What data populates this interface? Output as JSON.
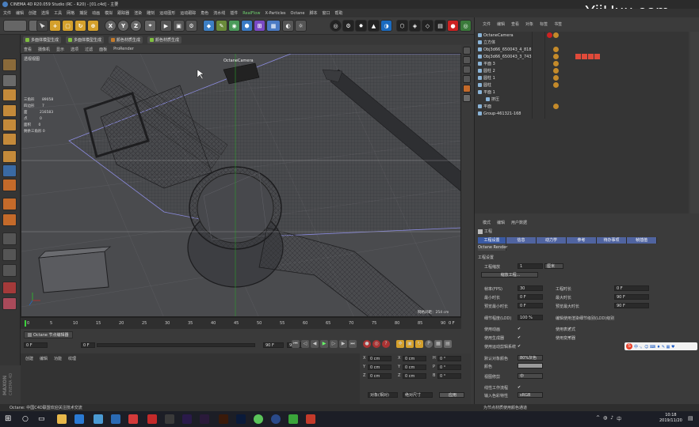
{
  "window": {
    "title": "CINEMA 4D R20.059 Studio (RC - R20) - [01.c4d] - 主要"
  },
  "watermark": "YiiHuu.com",
  "menu": [
    "文件",
    "编辑",
    "创建",
    "选择",
    "工具",
    "网格",
    "捕捉",
    "动画",
    "模拟",
    "跟踪器",
    "渲染",
    "雕刻",
    "运动图形",
    "运动跟踪",
    "角色",
    "流水线",
    "插件",
    "RealFlow",
    "X-Particles",
    "Octane",
    "脚本",
    "窗口",
    "帮助"
  ],
  "toolbar": {
    "axis": [
      "X",
      "Y",
      "Z"
    ]
  },
  "subtoolbar": [
    "多面体模型生成",
    "多面体模型生成",
    "颜色材质生成",
    "颜色材质生成"
  ],
  "viewport": {
    "menu": [
      "查看",
      "摄像机",
      "显示",
      "选项",
      "过滤",
      "面板",
      "ProRender"
    ],
    "view_name": "透视视图",
    "camera_label": "OctaneCamera",
    "stats": [
      {
        "label": "三角形",
        "value": "89058"
      },
      {
        "label": "四边形",
        "value": "7"
      },
      {
        "label": "面",
        "value": "216583"
      },
      {
        "label": "点",
        "value": "0"
      },
      {
        "label": "面积",
        "value": "0"
      }
    ],
    "stats_extra": "剩余三角形 0",
    "grid_spacing": "网格间距：254 cm"
  },
  "timeline": {
    "ticks": [
      "0",
      "5",
      "10",
      "15",
      "20",
      "25",
      "30",
      "35",
      "40",
      "45",
      "50",
      "55",
      "60",
      "65",
      "70",
      "75",
      "80",
      "85",
      "90"
    ],
    "end_label": "0 F"
  },
  "transport": {
    "octane_label": "Octane 节点编辑器",
    "start_frame": "0 F",
    "cur_frame": "0 F",
    "end_frame": "90 F",
    "end2": "90 F"
  },
  "material_panel": {
    "menu": [
      "创建",
      "编辑",
      "功能",
      "纹理"
    ]
  },
  "coords": {
    "rows": [
      {
        "a": "X",
        "av": "0 cm",
        "b": "X",
        "bv": "0 cm",
        "c": "H",
        "cv": "0 °"
      },
      {
        "a": "Y",
        "av": "0 cm",
        "b": "Y",
        "bv": "0 cm",
        "c": "P",
        "cv": "0 °"
      },
      {
        "a": "Z",
        "av": "0 cm",
        "b": "Z",
        "bv": "0 cm",
        "c": "B",
        "cv": "0 °"
      }
    ],
    "dropdown1": "对象(相对)",
    "dropdown2": "绝对尺寸",
    "apply": "应用"
  },
  "object_manager": {
    "menu": [
      "文件",
      "编辑",
      "查看",
      "对象",
      "标签",
      "书签"
    ],
    "objects": [
      {
        "name": "OctaneCamera",
        "color": "#8ab4d8"
      },
      {
        "name": "立方体",
        "color": "#8ab4d8"
      },
      {
        "name": "Obj3d66_650043_4_818",
        "color": "#8ab4d8"
      },
      {
        "name": "Obj3d66_650043_3_743",
        "color": "#8ab4d8"
      },
      {
        "name": "平面 3",
        "color": "#8ab4d8"
      },
      {
        "name": "圆柱 2",
        "color": "#8ab4d8"
      },
      {
        "name": "圆柱 1",
        "color": "#8ab4d8"
      },
      {
        "name": "圆柱",
        "color": "#8ab4d8"
      },
      {
        "name": "平面 1",
        "color": "#8ab4d8"
      },
      {
        "name": "挤压",
        "color": "#8ab4d8"
      },
      {
        "name": "平面",
        "color": "#8ab4d8"
      },
      {
        "name": "Group-461321-168",
        "color": "#8ab4d8"
      }
    ]
  },
  "attr_manager": {
    "menu": [
      "模式",
      "编辑",
      "用户数据"
    ],
    "section": "工程",
    "tabs": [
      "工程设置",
      "信息",
      "动力学",
      "参考",
      "待办事项",
      "帧插值"
    ],
    "tab2": "Octane Render",
    "group_title": "工程设置",
    "scale_label": "工程缩放",
    "scale_value": "1",
    "scale_unit": "厘米",
    "scale_button": "缩放工程...",
    "fields": [
      {
        "label": "帧率(FPS)",
        "value": "30"
      },
      {
        "label": "最小时长",
        "value": "0 F"
      },
      {
        "label": "预览最小时长",
        "value": "0 F"
      }
    ],
    "fields_right": [
      {
        "label": "工程时长",
        "value": "0 F"
      },
      {
        "label": "最大时长",
        "value": "90 F"
      },
      {
        "label": "预览最大时长",
        "value": "90 F"
      }
    ],
    "lod_label": "细节程度(LOD)",
    "lod_value": "100 %",
    "lod_check": "编辑使用渲染细节级别(LOD)级别",
    "checks_left": [
      "使用动画",
      "使用生成器",
      "使用运动剪辑系统"
    ],
    "checks_right": [
      "使用表达式",
      "使用变形器"
    ],
    "default_color_label": "默认对象颜色",
    "default_color_value": "80%灰色",
    "color_label": "颜色",
    "view_clip_label": "视图修剪",
    "view_clip_value": "中",
    "linear_label": "线性工作流程",
    "input_color_label": "输入色彩特性",
    "input_color_value": "sRGB",
    "footer": "为节点材质使用颜色通道"
  },
  "statusbar": {
    "text": "Octane: 中国C4D联盟欢迎关注技术交流"
  },
  "ime": {
    "text": "中 ·。☺ ⌨ ♦ ✎ ▦ ♥"
  },
  "taskbar": {
    "time": "10:18",
    "date": "2019/11/20"
  },
  "branding": {
    "maxon": "MAXON",
    "c4d": "CINEMA 4D"
  }
}
